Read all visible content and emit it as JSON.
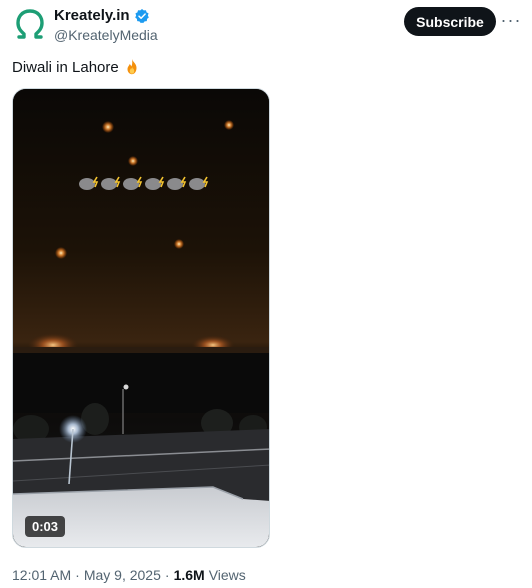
{
  "author": {
    "name": "Kreately.in",
    "handle": "@KreatelyMedia",
    "verified": true,
    "avatar_icon": "omega-logo",
    "accent_color": "#1d9e75"
  },
  "actions": {
    "subscribe_label": "Subscribe",
    "more_label": "···"
  },
  "tweet": {
    "text": "Diwali in Lahore",
    "emoji": "fire-emoji"
  },
  "media": {
    "type": "video",
    "duration": "0:03"
  },
  "meta": {
    "time": "12:01 AM",
    "separator": "·",
    "date": "May 9, 2025",
    "views_count": "1.6M",
    "views_label": "Views"
  }
}
